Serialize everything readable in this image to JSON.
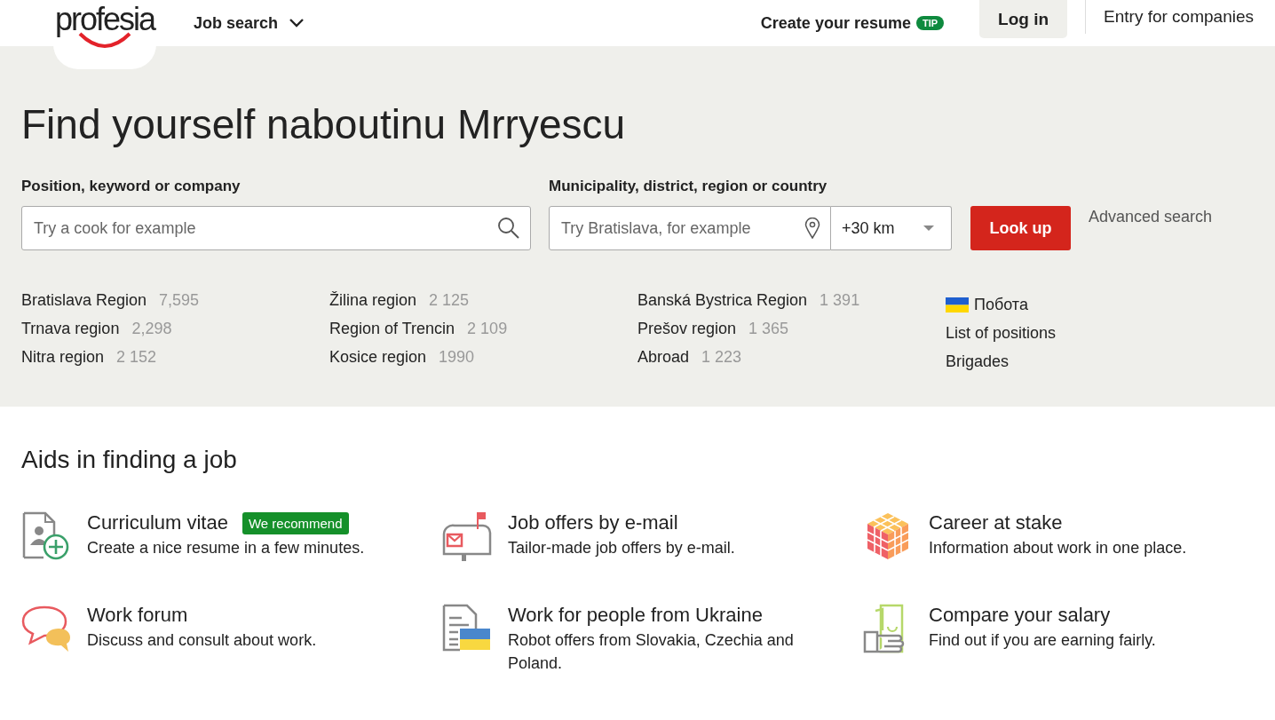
{
  "header": {
    "logo": "profesia",
    "nav": [
      {
        "label": "Job search",
        "kind": "dropdown"
      },
      {
        "label": "Create your resume",
        "kind": "tip",
        "badge": "TIP"
      },
      {
        "label": "Log in",
        "kind": "login"
      },
      {
        "label": "Entry for companies",
        "kind": "plain"
      }
    ]
  },
  "hero": {
    "title": "Find yourself naboutinu Mrryescu",
    "keyword": {
      "label": "Position, keyword or company",
      "placeholder": "Try a cook for example"
    },
    "location": {
      "label": "Municipality, district, region or country",
      "placeholder": "Try Bratislava, for example",
      "distance": "+30 km"
    },
    "search_button": "Look up",
    "advanced_link": "Advanced search",
    "regions": [
      [
        {
          "name": "Bratislava Region",
          "count": "7,595"
        },
        {
          "name": "Trnava region",
          "count": "2,298"
        },
        {
          "name": "Nitra region",
          "count": "2 152"
        }
      ],
      [
        {
          "name": "Žilina region",
          "count": "2 125"
        },
        {
          "name": "Region of Trencin",
          "count": "2 109"
        },
        {
          "name": "Kosice region",
          "count": "1990"
        }
      ],
      [
        {
          "name": "Banská Bystrica Region",
          "count": "1 391"
        },
        {
          "name": "Prešov region",
          "count": "1 365"
        },
        {
          "name": "Abroad",
          "count": "1 223"
        }
      ]
    ],
    "links": [
      {
        "label": "Побота",
        "kind": "flag"
      },
      {
        "label": "List of positions",
        "kind": "plain"
      },
      {
        "label": "Brigades",
        "kind": "plain"
      }
    ]
  },
  "aids": {
    "title": "Aids in finding a job",
    "items": [
      {
        "kind": "cv",
        "title": "Curriculum vitae",
        "badge": "We recommend",
        "text": "Create a nice resume in a few minutes."
      },
      {
        "kind": "mail",
        "title": "Job offers by e-mail",
        "text": "Tailor-made job offers by e-mail."
      },
      {
        "kind": "cube",
        "title": "Career at stake",
        "text": "Information about work in one place."
      },
      {
        "kind": "forum",
        "title": "Work forum",
        "text": "Discuss and consult about work."
      },
      {
        "kind": "ukraine",
        "title": "Work for people from Ukraine",
        "text": "Robot offers from Slovakia, Czechia and Poland."
      },
      {
        "kind": "salary",
        "title": "Compare your salary",
        "text": "Find out if you are earning fairly."
      }
    ]
  }
}
